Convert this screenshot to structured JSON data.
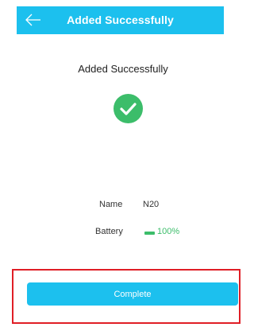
{
  "header": {
    "title": "Added Successfully",
    "back_icon": "arrow-left-icon"
  },
  "main": {
    "title": "Added Successfully",
    "status_icon": "check-circle-icon"
  },
  "device": {
    "name_label": "Name",
    "name_value": "N20",
    "battery_label": "Battery",
    "battery_value": "100%",
    "battery_level": 1.0
  },
  "footer": {
    "complete_label": "Complete"
  },
  "colors": {
    "accent": "#1cc0ee",
    "success": "#3cbd6a",
    "highlight": "#e01e26"
  }
}
